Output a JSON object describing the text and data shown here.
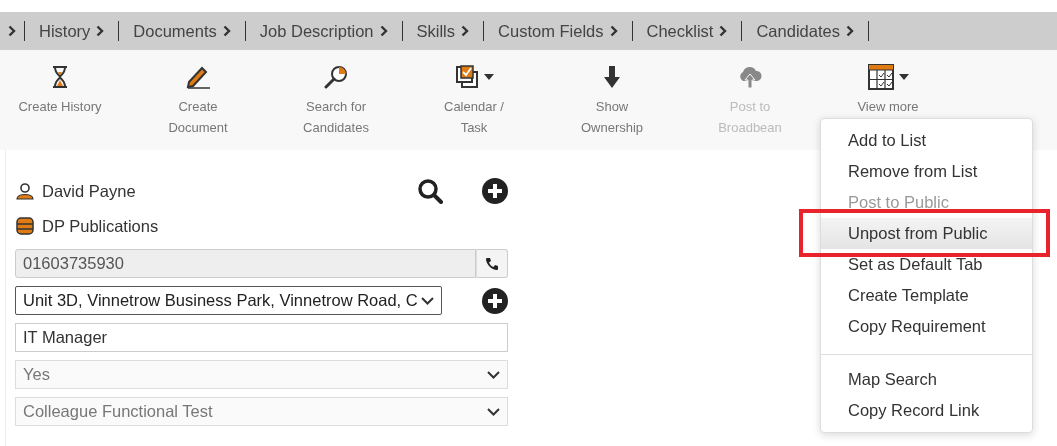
{
  "tab_bar": {
    "leading_chevron": true,
    "tabs": [
      {
        "label": "History"
      },
      {
        "label": "Documents"
      },
      {
        "label": "Job Description"
      },
      {
        "label": "Skills"
      },
      {
        "label": "Custom Fields"
      },
      {
        "label": "Checklist"
      },
      {
        "label": "Candidates"
      }
    ]
  },
  "toolbar": [
    {
      "label": "Create History",
      "disabled": false,
      "dropdown": false
    },
    {
      "label": "Create Document",
      "disabled": false,
      "dropdown": false
    },
    {
      "label": "Search for Candidates",
      "disabled": false,
      "dropdown": false
    },
    {
      "label": "Calendar / Task",
      "disabled": false,
      "dropdown": true
    },
    {
      "label": "Show Ownership",
      "disabled": false,
      "dropdown": false
    },
    {
      "label": "Post to Broadbean",
      "disabled": true,
      "dropdown": false
    },
    {
      "label": "View more",
      "disabled": false,
      "dropdown": true
    }
  ],
  "contact": {
    "name": "David Payne",
    "company": "DP Publications"
  },
  "form": [
    {
      "kind": "phone",
      "value": "01603735930",
      "disabled": true
    },
    {
      "kind": "select",
      "value": "Unit 3D, Vinnetrow Business Park, Vinnetrow Road, C",
      "disabled": false,
      "add_button": true
    },
    {
      "kind": "text",
      "value": "IT Manager",
      "disabled": false
    },
    {
      "kind": "select",
      "value": "Yes",
      "disabled": true,
      "add_button": false
    },
    {
      "kind": "select",
      "value": "Colleague Functional Test",
      "disabled": true,
      "add_button": false
    }
  ],
  "menu": {
    "groups": [
      [
        {
          "label": "Add to List",
          "disabled": false,
          "highlighted": false
        },
        {
          "label": "Remove from List",
          "disabled": false,
          "highlighted": false
        },
        {
          "label": "Post to Public",
          "disabled": true,
          "highlighted": false
        },
        {
          "label": "Unpost from Public",
          "disabled": false,
          "highlighted": true
        },
        {
          "label": "Set as Default Tab",
          "disabled": false,
          "highlighted": false
        },
        {
          "label": "Create Template",
          "disabled": false,
          "highlighted": false
        },
        {
          "label": "Copy Requirement",
          "disabled": false,
          "highlighted": false
        }
      ],
      [
        {
          "label": "Map Search",
          "disabled": false,
          "highlighted": false
        },
        {
          "label": "Copy Record Link",
          "disabled": false,
          "highlighted": false
        }
      ]
    ]
  }
}
